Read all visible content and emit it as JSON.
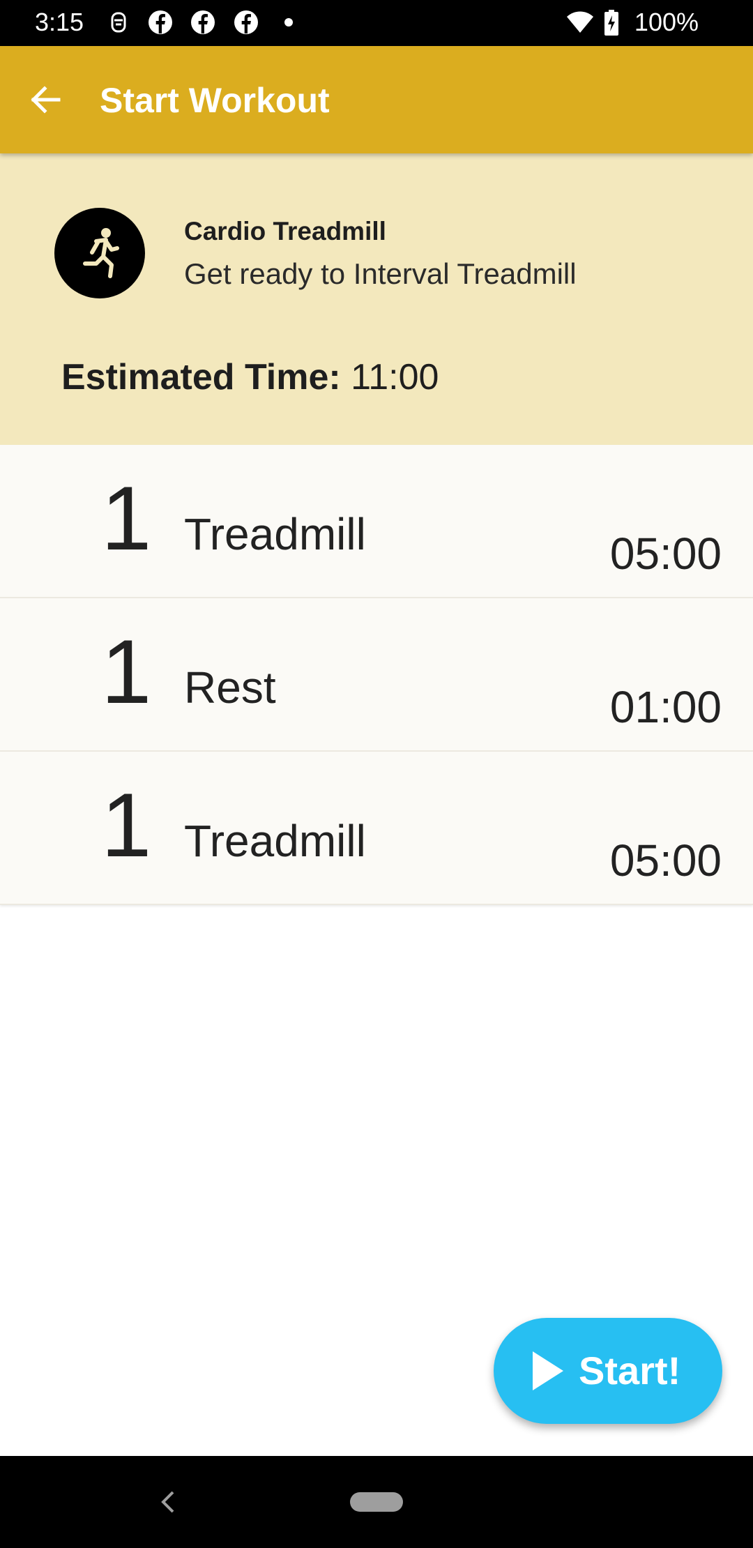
{
  "status_bar": {
    "time": "3:15",
    "battery": "100%",
    "icons": [
      "assistant-icon",
      "facebook-icon",
      "facebook-icon",
      "facebook-icon",
      "dot-icon",
      "wifi-icon",
      "battery-charging-icon"
    ]
  },
  "app_bar": {
    "title": "Start Workout",
    "color": "#dbad1f"
  },
  "header": {
    "workout_type": "Cardio Treadmill",
    "description": "Get ready to Interval Treadmill",
    "estimated_label": "Estimated Time:",
    "estimated_value": "11:00",
    "background": "#f3e8bd"
  },
  "steps": [
    {
      "count": "1",
      "name": "Treadmill",
      "duration": "05:00"
    },
    {
      "count": "1",
      "name": "Rest",
      "duration": "01:00"
    },
    {
      "count": "1",
      "name": "Treadmill",
      "duration": "05:00"
    }
  ],
  "fab": {
    "label": "Start!",
    "color": "#27bff2"
  }
}
